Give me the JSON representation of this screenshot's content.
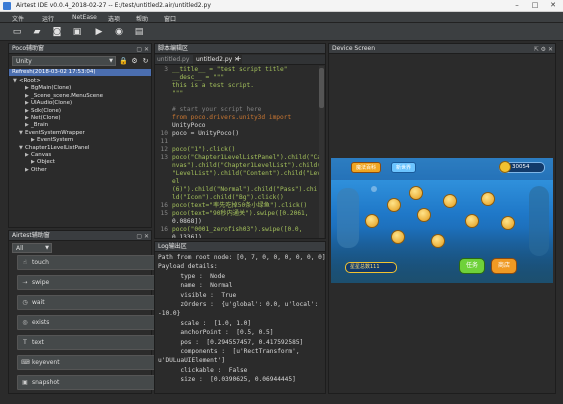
{
  "window": {
    "title": "Airtest IDE v0.0.4_2018-02-27 -- E:/test/untitled2.air/untitled2.py"
  },
  "menu": [
    "文件",
    "运行",
    "NetEase",
    "选项",
    "帮助",
    "窗口"
  ],
  "toolbar_icons": [
    "new-file-icon",
    "open-folder-icon",
    "save-icon",
    "save-all-icon",
    "run-icon",
    "stop-icon",
    "report-icon"
  ],
  "poco_panel": {
    "title": "Poco辅助窗",
    "mode": "Unity",
    "refresh_row": "Refresh(2018-03-02 17:53:04)",
    "tree": [
      {
        "label": "<Root>",
        "depth": 0,
        "expanded": true
      },
      {
        "label": "BgMain(Clone)",
        "depth": 2,
        "expanded": false
      },
      {
        "label": "_Scene_scene.MenuScene",
        "depth": 2,
        "expanded": false
      },
      {
        "label": "UIAudio(Clone)",
        "depth": 2,
        "expanded": false
      },
      {
        "label": "Sdk(Clone)",
        "depth": 2,
        "expanded": false
      },
      {
        "label": "Net(Clone)",
        "depth": 2,
        "expanded": false
      },
      {
        "label": "_Brain",
        "depth": 2,
        "expanded": false
      },
      {
        "label": "EventSystemWrapper",
        "depth": 1,
        "expanded": true
      },
      {
        "label": "EventSystem",
        "depth": 3,
        "expanded": false
      },
      {
        "label": "Chapter1LevelListPanel",
        "depth": 1,
        "expanded": true
      },
      {
        "label": "Canvas",
        "depth": 2,
        "expanded": false
      },
      {
        "label": "Object",
        "depth": 3,
        "expanded": false
      },
      {
        "label": "Other",
        "depth": 2,
        "expanded": false
      }
    ]
  },
  "airtest_panel": {
    "title": "Airtest辅助窗",
    "filter": "All",
    "actions": [
      "touch",
      "swipe",
      "wait",
      "exists",
      "text",
      "keyevent",
      "snapshot"
    ]
  },
  "editor": {
    "title": "脚本编辑区",
    "tab": "untitled2.py",
    "tab_prev": "untitled.py",
    "lines": [
      {
        "n": "3",
        "text": "__title__ = \"test script title\""
      },
      {
        "n": "",
        "text": "__desc__ = \"\"\""
      },
      {
        "n": "",
        "text": "this is a test script."
      },
      {
        "n": "",
        "text": "\"\"\""
      },
      {
        "n": "",
        "text": ""
      },
      {
        "n": "",
        "text": "# start your script here"
      },
      {
        "n": "",
        "text": "from poco.drivers.unity3d import"
      },
      {
        "n": "",
        "text": "UnityPoco"
      },
      {
        "n": "10",
        "text": "poco = UnityPoco()"
      },
      {
        "n": "11",
        "text": ""
      },
      {
        "n": "12",
        "text": "poco(\"1\").click()"
      },
      {
        "n": "13",
        "text": "poco(\"Chapter1LevelListPanel\").child(\"Ca"
      },
      {
        "n": "",
        "text": "nvas\").child(\"Chapter1LevelList\").child("
      },
      {
        "n": "",
        "text": "\"LevelList\").child(\"Content\").child(\"Lev"
      },
      {
        "n": "",
        "text": "el"
      },
      {
        "n": "",
        "text": "(6)\").child(\"Normal\").child(\"Pass\").chi"
      },
      {
        "n": "",
        "text": "ld(\"Icon\").child(\"Bg\").click()"
      },
      {
        "n": "16",
        "text": "poco(text=\"率先吃掉50条小绿鱼\").click()"
      },
      {
        "n": "15",
        "text": "poco(text=\"90秒内通关\").swipe([0.2061,"
      },
      {
        "n": "",
        "text": "0.0868])"
      },
      {
        "n": "16",
        "text": "poco(\"0001_zerofish03\").swipe([0.0,"
      },
      {
        "n": "",
        "text": "0.1336])"
      }
    ]
  },
  "log": {
    "title": "Log输出区",
    "lines": [
      "Path from root node: [0, 7, 0, 0, 0, 0, 0, 0]",
      "Payload details:",
      "      type :  Node",
      "      name :  Normal",
      "      visible :  True",
      "      zOrders :  {u'global': 0.0, u'local':",
      "-10.0}",
      "      scale :  [1.0, 1.0]",
      "      anchorPoint :  [0.5, 0.5]",
      "      pos :  [0.294557457, 0.417592585]",
      "      components :  [u'RectTransform',",
      "u'DULuaUIElement']",
      "      clickable :  False",
      "      size :  [0.0390625, 0.06944445]"
    ]
  },
  "device": {
    "title": "Device Screen",
    "game_coin": "30054",
    "game_badge_left": "魔法百科",
    "game_badge_right": "新世界",
    "game_star_total": "星星总数111",
    "game_btn_left": "任务",
    "game_btn_right": "商店"
  },
  "colors": {
    "accent": "#4b6eaf",
    "panel": "#2b2b2b",
    "header": "#3a3d40",
    "game_sea": "#1f78c8"
  }
}
